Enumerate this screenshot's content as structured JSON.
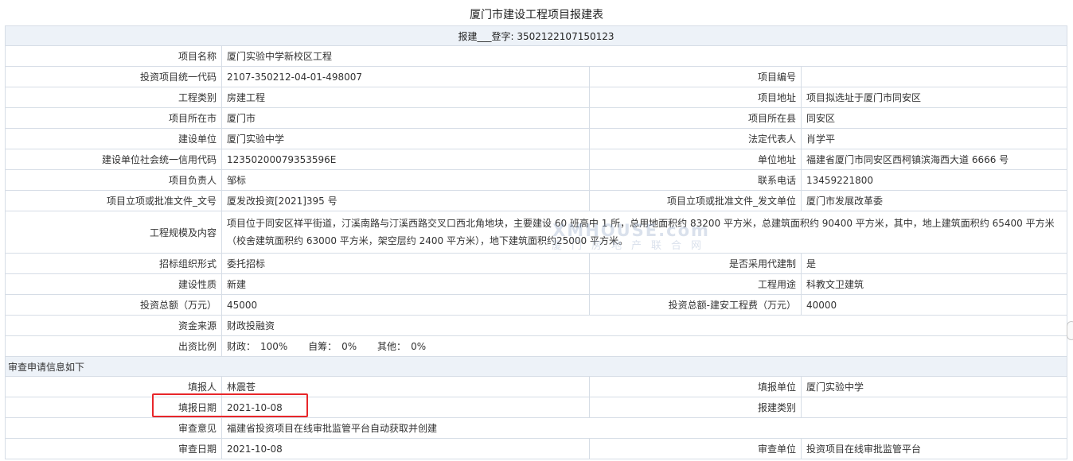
{
  "title": "厦门市建设工程项目报建表",
  "header_line": "报建___登字: 3502122107150123",
  "rows": {
    "project_name": {
      "label": "项目名称",
      "value": "厦门实验中学新校区工程"
    },
    "invest_code": {
      "label": "投资项目统一代码",
      "value": "2107-350212-04-01-498007"
    },
    "project_no": {
      "label": "项目编号",
      "value": ""
    },
    "eng_type": {
      "label": "工程类别",
      "value": "房建工程"
    },
    "address": {
      "label": "项目地址",
      "value": "项目拟选址于厦门市同安区"
    },
    "city": {
      "label": "项目所在市",
      "value": "厦门市"
    },
    "county": {
      "label": "项目所在县",
      "value": "同安区"
    },
    "builder": {
      "label": "建设单位",
      "value": "厦门实验中学"
    },
    "legal_rep": {
      "label": "法定代表人",
      "value": "肖学平"
    },
    "credit_code": {
      "label": "建设单位社会统一信用代码",
      "value": "12350200079353596E"
    },
    "unit_address": {
      "label": "单位地址",
      "value": "福建省厦门市同安区西柯镇滨海西大道 6666 号"
    },
    "project_lead": {
      "label": "项目负责人",
      "value": "邹标"
    },
    "phone": {
      "label": "联系电话",
      "value": "13459221800"
    },
    "approval_doc": {
      "label": "项目立项或批准文件_文号",
      "value": "厦发改投资[2021]395 号"
    },
    "approval_unit": {
      "label": "项目立项或批准文件_发文单位",
      "value": "厦门市发展改革委"
    },
    "scale": {
      "label": "工程规模及内容",
      "value": "项目位于同安区祥平街道，汀溪南路与汀溪西路交叉口西北角地块，主要建设 60 班高中 1 所，总用地面积约 83200 平方米，总建筑面积约 90400 平方米，其中，地上建筑面积约 65400 平方米（校舍建筑面积约 63000 平方米，架空层约 2400 平方米），地下建筑面积约25000 平方米。"
    },
    "bid_form": {
      "label": "招标组织形式",
      "value": "委托招标"
    },
    "agent_build": {
      "label": "是否采用代建制",
      "value": "是"
    },
    "nature": {
      "label": "建设性质",
      "value": "新建"
    },
    "usage": {
      "label": "工程用途",
      "value": "科教文卫建筑"
    },
    "total_invest": {
      "label": "投资总额（万元）",
      "value": "45000"
    },
    "build_invest": {
      "label": "投资总额-建安工程费（万元）",
      "value": "40000"
    },
    "fund_source": {
      "label": "资金来源",
      "value": "财政投融资"
    },
    "ratio": {
      "label": "出资比例",
      "fiscal_key": "财政：",
      "fiscal_val": "100%",
      "self_key": "自筹：",
      "self_val": "0%",
      "other_key": "其他：",
      "other_val": "0%"
    }
  },
  "review_section": "审查申请信息如下",
  "review": {
    "filler": {
      "label": "填报人",
      "value": "林震苍"
    },
    "filler_unit": {
      "label": "填报单位",
      "value": "厦门实验中学"
    },
    "fill_date": {
      "label": "填报日期",
      "value": "2021-10-08"
    },
    "report_type": {
      "label": "报建类别",
      "value": ""
    },
    "opinion": {
      "label": "审查意见",
      "value": "福建省投资项目在线审批监管平台自动获取并创建"
    },
    "review_date": {
      "label": "审查日期",
      "value": "2021-10-08"
    },
    "review_unit": {
      "label": "审查单位",
      "value": "投资项目在线审批监管平台"
    }
  },
  "watermark": {
    "line1": "XMHOUSE.com",
    "line2": "厦门房地产联合网"
  },
  "colors": {
    "header_bg": "#edf2f8",
    "border": "#d6dde6",
    "highlight": "#e8262a"
  }
}
